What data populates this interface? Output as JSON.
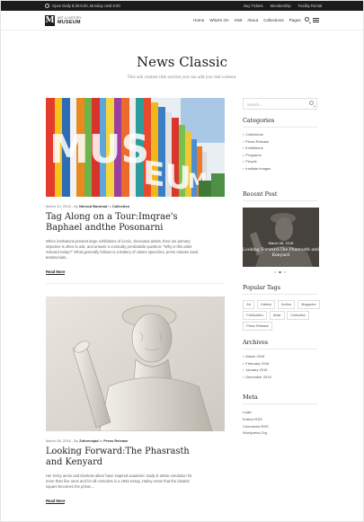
{
  "topbar": {
    "hours": "Open Daily 8:30-5:00, Monday Until 6:00",
    "links": [
      "Buy Tickets",
      "Membership",
      "Facility Rental"
    ]
  },
  "header": {
    "logo_mark": "M",
    "logo_small": "ART & HISTORY",
    "logo_big": "MUSEUM",
    "nav": [
      "Home",
      "What's On",
      "Visit",
      "About",
      "Collections",
      "Pages"
    ],
    "icons": [
      "search-icon",
      "menu-icon"
    ]
  },
  "page": {
    "title": "News Classic",
    "subtitle": "This sub content title section you can add you real content."
  },
  "posts": [
    {
      "date": "March 10, 2016",
      "by": " - By ",
      "author": "Nimrod Barshad",
      "in": " In ",
      "category": "Collection",
      "title": "Tag Along on a Tour:Imqrae's Baphael andthe Posonarni",
      "excerpt": "When institutions present large exhibitions of iconic, deceased artists, their are primary objective is often to ask, and answer a comically predictable question: \"Why is this artist relevant today?\" What generally follows is a battery of claims speeches, press release sand testimonials...",
      "read_more": "Read More"
    },
    {
      "date": "March 08, 2016",
      "by": " - By ",
      "author": "Zohrenejad",
      "in": " In ",
      "category": "Press Release",
      "title": "Looking Forward:The Phasrasth and Kenyard",
      "excerpt": "Her tricky annie and timeless allure have inspired academic study E arteto emulation for more than five ones and for all centuries in a 1962 essay, Hailey wrote that the ideatist square becomes the prison...",
      "read_more": "Read More"
    }
  ],
  "sidebar": {
    "search_placeholder": "Search...",
    "categories_title": "Categories",
    "categories": [
      "Collections",
      "Press Release",
      "Exhibitions",
      "Programe",
      "People",
      "Institute images"
    ],
    "recent_title": "Recent Post",
    "recent": {
      "date": "March 08, 2016",
      "title": "Looking Forward:The Phasrasth and Kenyard"
    },
    "tags_title": "Popular Tags",
    "tags": [
      "Art",
      "Gallery",
      "Author",
      "Magazine",
      "Publication",
      "Artist",
      "Collection",
      "Press Release"
    ],
    "archives_title": "Archives",
    "archives": [
      "March 2016",
      "February 2016",
      "January 2016",
      "December 2015"
    ],
    "meta_title": "Meta",
    "meta": [
      "Login",
      "Entries RSS",
      "Comments RSS",
      "Wordpress.Org"
    ]
  },
  "colors": {
    "topbar_bg": "#1b1b1b",
    "text_dark": "#222222",
    "muted": "#777777"
  }
}
